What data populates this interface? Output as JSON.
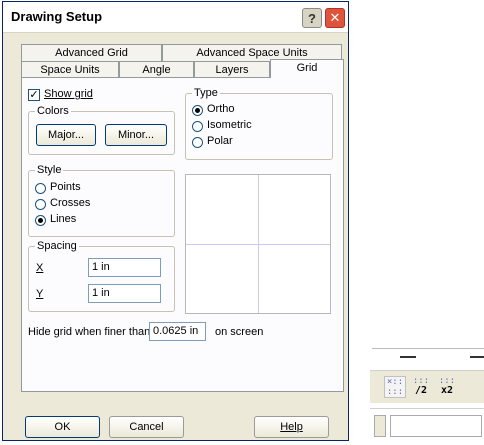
{
  "dialog": {
    "title": "Drawing Setup",
    "help_glyph": "?",
    "close_glyph": "✕",
    "tabs_row1": [
      "Advanced Grid",
      "Advanced Space Units"
    ],
    "tabs_row2": [
      "Space Units",
      "Angle",
      "Layers",
      "Grid"
    ],
    "active_tab": "Grid"
  },
  "grid": {
    "show_grid_label": "Show grid",
    "show_grid_checked": true,
    "check_glyph": "✓",
    "colors_legend": "Colors",
    "major_label": "Major...",
    "minor_label": "Minor...",
    "type_legend": "Type",
    "type_options": [
      "Ortho",
      "Isometric",
      "Polar"
    ],
    "type_selected": "Ortho",
    "style_legend": "Style",
    "style_options": [
      "Points",
      "Crosses",
      "Lines"
    ],
    "style_selected": "Lines",
    "spacing_legend": "Spacing",
    "x_label": "X",
    "x_value": "1 in",
    "y_label": "Y",
    "y_value": "1 in",
    "hide_label": "Hide grid when finer than",
    "hide_value": "0.0625 in",
    "hide_suffix": "on screen"
  },
  "footer": {
    "ok_label": "OK",
    "cancel_label": "Cancel",
    "help_label": "Help"
  },
  "toolbar_fragment": {
    "icon1_caption": "/2",
    "icon2_caption": "x2"
  }
}
